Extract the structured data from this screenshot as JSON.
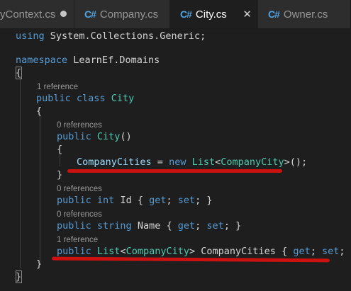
{
  "tabs": [
    {
      "label": "yContext.cs",
      "icon": "",
      "state": "modified"
    },
    {
      "label": "Company.cs",
      "icon": "C#",
      "state": "normal"
    },
    {
      "label": "City.cs",
      "icon": "C#",
      "state": "active"
    },
    {
      "label": "Owner.cs",
      "icon": "C#",
      "state": "normal"
    }
  ],
  "colors": {
    "keyword": "#569cd6",
    "type": "#4ec9b0",
    "identifier": "#9cdcfe",
    "plain": "#d4d4d4",
    "codelens": "#999999",
    "annotation": "#cc1111",
    "tab_icon": "#4fa4e6"
  },
  "code": {
    "line1": {
      "kw": "using",
      "ns": "System.Collections.Generic",
      "punct": ";"
    },
    "line2": {
      "kw": "namespace",
      "ns": "LearnEf.Domains"
    },
    "open_ns": "{",
    "class_lens": "1 reference",
    "class_decl": {
      "kw1": "public",
      "kw2": "class",
      "name": "City"
    },
    "open_class": "{",
    "ctor_lens": "0 references",
    "ctor_decl": {
      "kw": "public",
      "name": "City",
      "parens": "()"
    },
    "open_ctor": "{",
    "ctor_body": {
      "prop": "CompanyCities",
      "eq": " = ",
      "kw": "new",
      "type": "List",
      "lt": "<",
      "generic": "CompanyCity",
      "rest": ">();"
    },
    "close_ctor": "}",
    "id_lens": "0 references",
    "id_decl": {
      "kw1": "public",
      "kw2": "int",
      "name": "Id",
      "ob": "{ ",
      "get": "get",
      "semi1": "; ",
      "set": "set",
      "semi2": "; }"
    },
    "name_lens": "0 references",
    "name_decl": {
      "kw1": "public",
      "kw2": "string",
      "name": "Name",
      "ob": "{ ",
      "get": "get",
      "semi1": "; ",
      "set": "set",
      "semi2": "; }"
    },
    "cc_lens": "1 reference",
    "cc_decl": {
      "kw": "public",
      "type": "List",
      "lt": "<",
      "generic": "CompanyCity",
      "gt": ">",
      "name": "CompanyCities",
      "ob": "{ ",
      "get": "get",
      "semi1": "; ",
      "set": "set",
      "semi2": "; }"
    },
    "close_class": "}",
    "close_ns": "}"
  }
}
